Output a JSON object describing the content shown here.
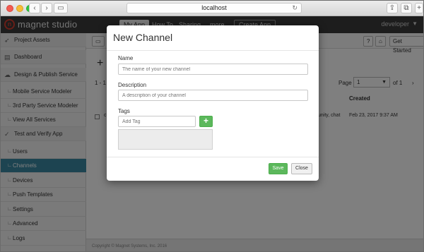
{
  "browser": {
    "url": "localhost",
    "back_icon": "chevron-left",
    "forward_icon": "chevron-right"
  },
  "app": {
    "logo_text": "magnet studio",
    "tabs": [
      "My App",
      "How To",
      "Sharing",
      "more"
    ],
    "create_app_label": "Create App",
    "user_label": "developer"
  },
  "sidebar": {
    "items": [
      {
        "label": "Project Assets",
        "icon": "rocket-icon",
        "kind": "section"
      },
      {
        "label": "Dashboard",
        "icon": "dashboard-icon",
        "kind": "section"
      },
      {
        "label": "Design & Publish Service",
        "icon": "cloud-icon",
        "kind": "section"
      },
      {
        "label": "Mobile Service Modeler",
        "kind": "sub"
      },
      {
        "label": "3rd Party Service Modeler",
        "kind": "sub"
      },
      {
        "label": "View All Services",
        "kind": "sub"
      },
      {
        "label": "Test and Verify App",
        "icon": "check-icon",
        "kind": "section"
      },
      {
        "label": "Users",
        "kind": "sub"
      },
      {
        "label": "Channels",
        "kind": "sub",
        "active": true
      },
      {
        "label": "Devices",
        "kind": "sub"
      },
      {
        "label": "Push Templates",
        "kind": "sub"
      },
      {
        "label": "Settings",
        "kind": "sub"
      },
      {
        "label": "Advanced",
        "kind": "sub"
      },
      {
        "label": "Logs",
        "kind": "sub"
      }
    ]
  },
  "main": {
    "help_label": "?",
    "get_started_label": "Get Started",
    "add_label": "+",
    "count_label": "1 - 1",
    "page_label": "Page",
    "page_value": "1",
    "of_label": "of 1",
    "created_header": "Created",
    "row": {
      "name_cell": "c",
      "tags_cell": "unity, chat",
      "created_cell": "Feb 23, 2017 9:37 AM"
    },
    "footer": "Copyright © Magnet Systems, Inc. 2016"
  },
  "modal": {
    "title": "New Channel",
    "name_label": "Name",
    "name_placeholder": "The name of your new channel",
    "description_label": "Description",
    "description_placeholder": "A description of your channel",
    "tags_label": "Tags",
    "tag_placeholder": "Add Tag",
    "add_tag_label": "+",
    "save_label": "Save",
    "close_label": "Close"
  },
  "colors": {
    "accent": "#3a88a3",
    "success": "#5cb85c",
    "brand": "#d33c2f"
  }
}
